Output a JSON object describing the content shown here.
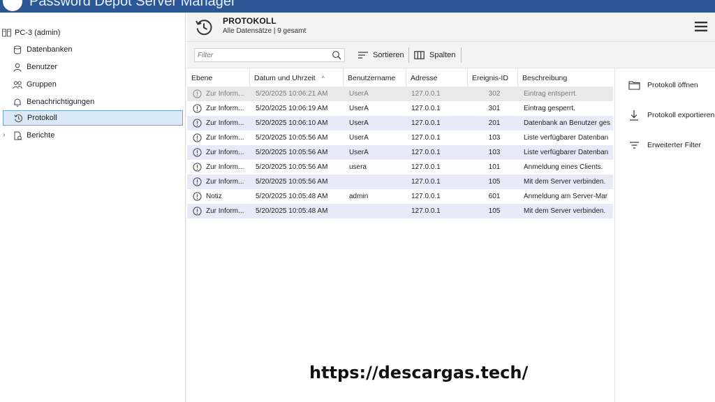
{
  "window": {
    "title": "Password Depot Server Manager",
    "accent": "#2b5797"
  },
  "sidebar": {
    "root_label": "PC-3 (admin)",
    "items": [
      {
        "label": "Datenbanken",
        "icon": "database-icon"
      },
      {
        "label": "Benutzer",
        "icon": "user-icon"
      },
      {
        "label": "Gruppen",
        "icon": "group-icon"
      },
      {
        "label": "Benachrichtigungen",
        "icon": "bell-icon"
      },
      {
        "label": "Protokoll",
        "icon": "history-icon",
        "selected": true
      },
      {
        "label": "Berichte",
        "icon": "report-icon"
      }
    ],
    "selected_color": "#dbe9f7"
  },
  "header": {
    "title": "PROTOKOLL",
    "subtitle": "Alle Datensätze | 9 gesamt"
  },
  "toolbar": {
    "filter_placeholder": "Filter",
    "sort_label": "Sortieren",
    "columns_label": "Spalten"
  },
  "table": {
    "columns": [
      "Ebene",
      "Datum und Uhrzeit",
      "Benutzername",
      "Adresse",
      "Ereignis-ID",
      "Beschreibung"
    ],
    "sort_indicator": "^",
    "rows": [
      {
        "level": "Zur Inform...",
        "datetime": "5/20/2025 10:06:21 AM",
        "user": "UserA",
        "address": "127.0.0.1",
        "event_id": "302",
        "description": "Eintrag entsperrt."
      },
      {
        "level": "Zur Inform...",
        "datetime": "5/20/2025 10:06:19 AM",
        "user": "UserA",
        "address": "127.0.0.1",
        "event_id": "301",
        "description": "Eintrag gesperrt."
      },
      {
        "level": "Zur Inform...",
        "datetime": "5/20/2025 10:06:10 AM",
        "user": "UserA",
        "address": "127.0.0.1",
        "event_id": "201",
        "description": "Datenbank an Benutzer ges"
      },
      {
        "level": "Zur Inform...",
        "datetime": "5/20/2025 10:05:56 AM",
        "user": "UserA",
        "address": "127.0.0.1",
        "event_id": "103",
        "description": "Liste verfügbarer Datenban"
      },
      {
        "level": "Zur Inform...",
        "datetime": "5/20/2025 10:05:56 AM",
        "user": "UserA",
        "address": "127.0.0.1",
        "event_id": "103",
        "description": "Liste verfügbarer Datenban"
      },
      {
        "level": "Zur Inform...",
        "datetime": "5/20/2025 10:05:56 AM",
        "user": "usera",
        "address": "127.0.0.1",
        "event_id": "101",
        "description": "Anmeldung eines Clients."
      },
      {
        "level": "Zur Inform...",
        "datetime": "5/20/2025 10:05:56 AM",
        "user": "",
        "address": "127.0.0.1",
        "event_id": "105",
        "description": "Mit dem Server verbinden."
      },
      {
        "level": "Notiz",
        "datetime": "5/20/2025 10:05:48 AM",
        "user": "admin",
        "address": "127.0.0.1",
        "event_id": "601",
        "description": "Anmeldung am Server-Mar"
      },
      {
        "level": "Zur Inform...",
        "datetime": "5/20/2025 10:05:48 AM",
        "user": "",
        "address": "127.0.0.1",
        "event_id": "105",
        "description": "Mit dem Server verbinden."
      }
    ],
    "alt_row_color": "#e8eaf8"
  },
  "actions": [
    {
      "label": "Protokoll öffnen",
      "icon": "folder-icon"
    },
    {
      "label": "Protokoll exportieren",
      "icon": "download-icon"
    },
    {
      "label": "Erweiterter Filter",
      "icon": "filter-icon"
    }
  ],
  "watermark": "https://descargas.tech/"
}
